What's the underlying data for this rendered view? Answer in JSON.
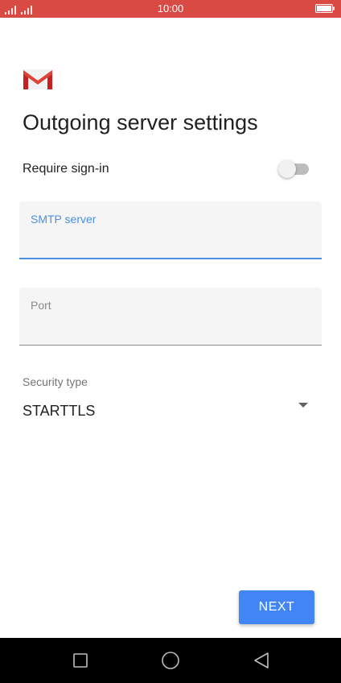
{
  "status_bar": {
    "time": "10:00",
    "background_color": "#d94a45",
    "signal_icon": "signal-icon",
    "battery_icon": "battery-icon"
  },
  "header": {
    "logo_icon": "gmail-logo-icon",
    "title": "Outgoing server settings"
  },
  "require_sign_in": {
    "label": "Require sign-in",
    "enabled": false
  },
  "smtp_field": {
    "label": "SMTP server",
    "value": "",
    "focused": true,
    "accent_color": "#4a90e2"
  },
  "port_field": {
    "label": "Port",
    "value": ""
  },
  "security": {
    "label": "Security type",
    "selected": "STARTTLS",
    "dropdown_icon": "dropdown-arrow-icon"
  },
  "actions": {
    "next_label": "NEXT",
    "button_color": "#4285f4"
  },
  "nav_bar": {
    "recents_icon": "recents-icon",
    "home_icon": "home-icon",
    "back_icon": "back-icon"
  }
}
